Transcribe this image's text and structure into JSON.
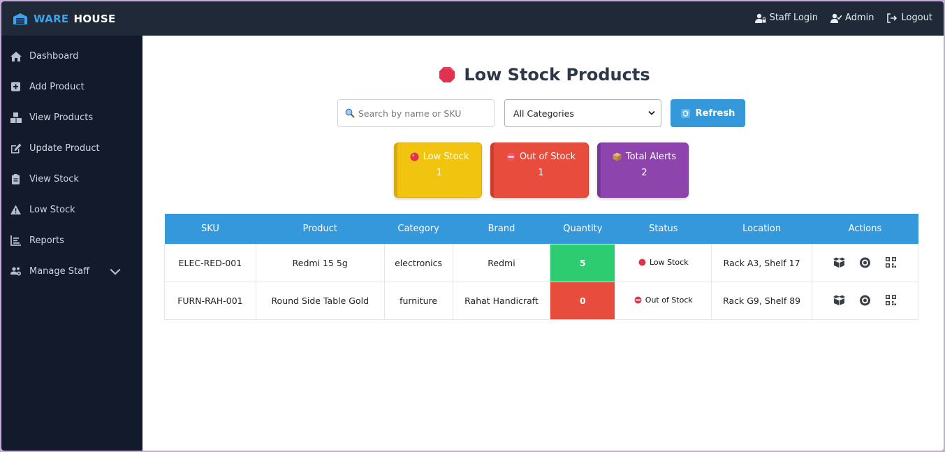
{
  "brand": {
    "ware": "WARE",
    "house": "HOUSE",
    "icon": "warehouse-icon",
    "color": "#3ba3f0"
  },
  "topnav": [
    {
      "label": "Staff Login",
      "icon": "user-lock-icon"
    },
    {
      "label": "Admin",
      "icon": "user-check-icon"
    },
    {
      "label": "Logout",
      "icon": "logout-icon"
    }
  ],
  "sidebar": {
    "items": [
      {
        "label": "Dashboard",
        "icon": "home-icon"
      },
      {
        "label": "Add Product",
        "icon": "plus-square-icon"
      },
      {
        "label": "View Products",
        "icon": "boxes-icon"
      },
      {
        "label": "Update Product",
        "icon": "edit-icon"
      },
      {
        "label": "View Stock",
        "icon": "clipboard-icon"
      },
      {
        "label": "Low Stock",
        "icon": "warning-icon"
      },
      {
        "label": "Reports",
        "icon": "chart-icon"
      },
      {
        "label": "Manage Staff",
        "icon": "users-gear-icon"
      }
    ]
  },
  "page": {
    "title": "Low Stock Products",
    "title_icon": "stop-sign-icon"
  },
  "filters": {
    "search_placeholder": "Search by name or SKU",
    "category_selected": "All Categories",
    "refresh_label": "Refresh"
  },
  "summary": {
    "low": {
      "label": "Low Stock",
      "value": "1",
      "color": "#f1c40f"
    },
    "out": {
      "label": "Out of Stock",
      "value": "1",
      "color": "#e74c3c"
    },
    "total": {
      "label": "Total Alerts",
      "value": "2",
      "color": "#8e44ad"
    }
  },
  "table": {
    "headers": [
      "SKU",
      "Product",
      "Category",
      "Brand",
      "Quantity",
      "Status",
      "Location",
      "Actions"
    ],
    "rows": [
      {
        "sku": "ELEC-RED-001",
        "product": "Redmi 15 5g",
        "category": "electronics",
        "brand": "Redmi",
        "quantity": "5",
        "status": "Low Stock",
        "location": "Rack A3, Shelf 17"
      },
      {
        "sku": "FURN-RAH-001",
        "product": "Round Side Table Gold",
        "category": "furniture",
        "brand": "Rahat Handicraft",
        "quantity": "0",
        "status": "Out of Stock",
        "location": "Rack G9, Shelf 89"
      }
    ],
    "action_icons": [
      "boxes-icon",
      "eye-icon",
      "qrcode-icon"
    ]
  }
}
